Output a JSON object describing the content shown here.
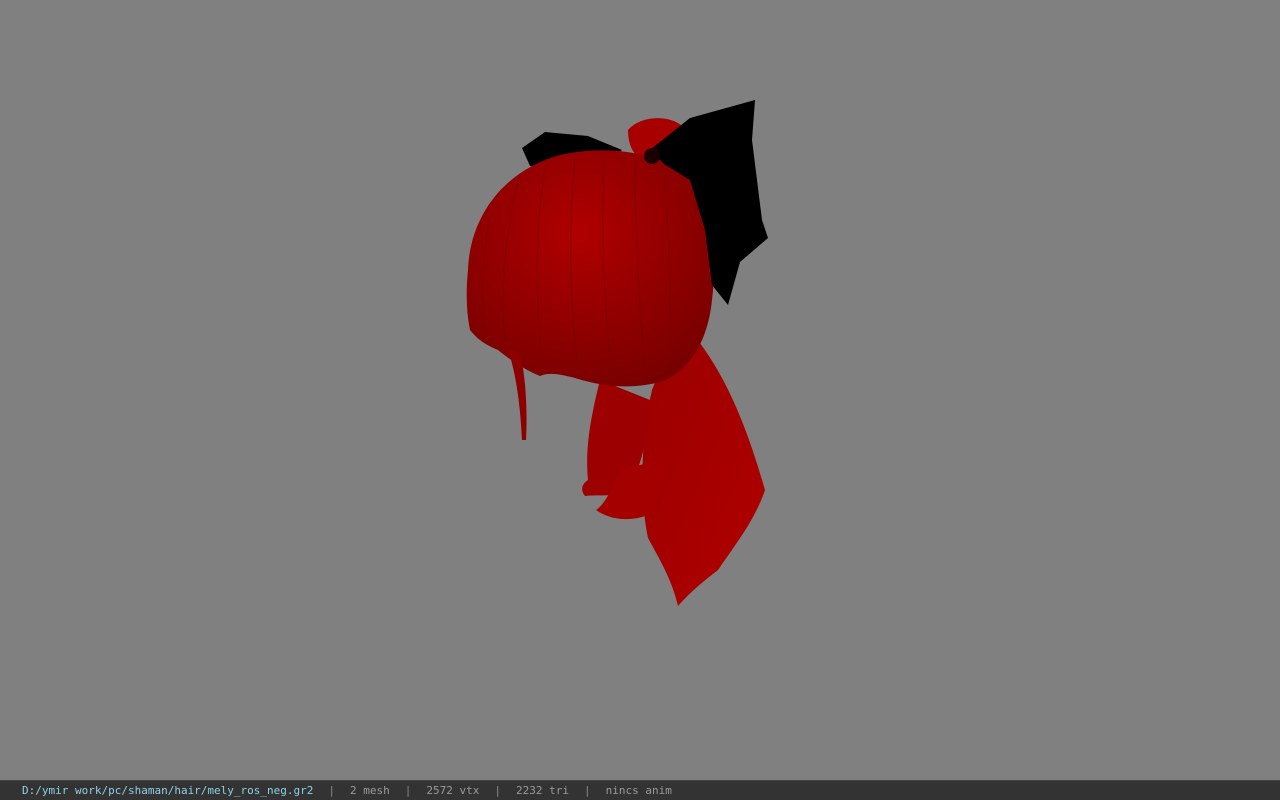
{
  "viewport": {
    "background_color": "#808080",
    "model": {
      "hair_color": "#a00000",
      "hair_shadow_color": "#6e0000",
      "bow_color": "#000000"
    }
  },
  "status_bar": {
    "file_path": "D:/ymir work/pc/shaman/hair/mely_ros_neg.gr2",
    "separator": "|",
    "mesh_count": "2 mesh",
    "vertex_count": "2572 vtx",
    "triangle_count": "2232 tri",
    "anim_status": "nincs anim",
    "path_color": "#8fd0e6",
    "text_color": "#9a9a9a"
  }
}
